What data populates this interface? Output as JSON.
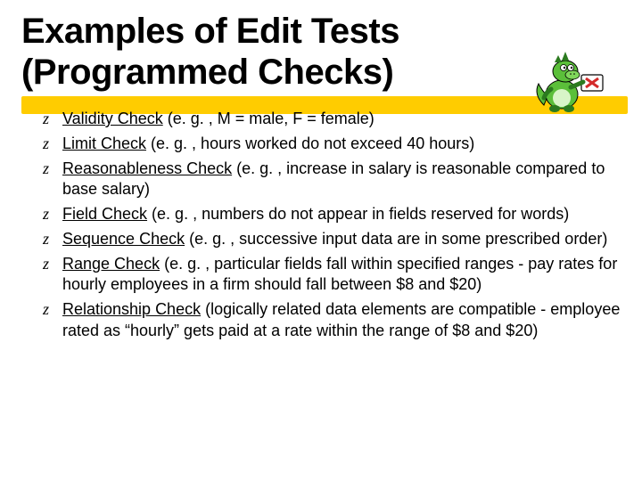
{
  "title_line1": "Examples of Edit Tests",
  "title_line2": "(Programmed Checks)",
  "items": [
    {
      "term": "Validity Check",
      "rest": " (e. g. , M = male, F = female)"
    },
    {
      "term": "Limit Check",
      "rest": " (e. g. , hours worked do not exceed 40 hours)"
    },
    {
      "term": "Reasonableness Check",
      "rest": " (e. g. , increase in salary is reasonable compared to base salary)"
    },
    {
      "term": "Field Check",
      "rest": " (e. g. , numbers do not appear in fields reserved for words)"
    },
    {
      "term": "Sequence Check",
      "rest": " (e. g. , successive input data are in some prescribed order)"
    },
    {
      "term": "Range Check",
      "rest": " (e. g. , particular fields fall within specified ranges - pay rates for hourly employees in a firm should fall between $8 and $20)"
    },
    {
      "term": "Relationship Check",
      "rest": " (logically related data elements are compatible - employee rated as “hourly” gets paid at a rate within the range of $8 and $20)"
    }
  ],
  "colors": {
    "accent": "#ffcc00",
    "mascot_green": "#5bbf3a",
    "mascot_dark": "#2b7a1f",
    "mascot_red": "#d42b2b"
  }
}
